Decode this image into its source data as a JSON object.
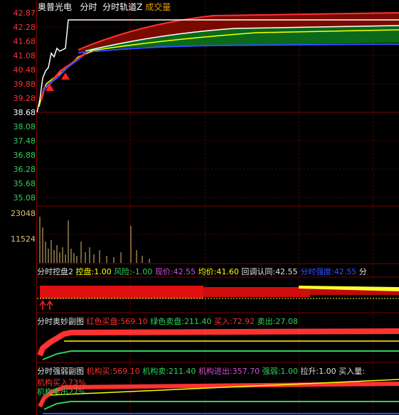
{
  "header": {
    "stock_name": "奥普光电",
    "tab_timeshare": "分时",
    "indicator_channel": "分时轨道Z",
    "indicator_volume": "成交量"
  },
  "price_axis": [
    "42.87",
    "42.28",
    "41.68",
    "41.08",
    "40.48",
    "39.88",
    "39.28",
    "38.68",
    "38.08",
    "37.48",
    "36.88",
    "36.28",
    "35.68",
    "35.08"
  ],
  "volume_axis": [
    "23048",
    "11524"
  ],
  "panel1": {
    "title": "分时控盘2",
    "items": [
      {
        "label": "控盘:",
        "value": "1.00",
        "color": "#ffff00"
      },
      {
        "label": "风险:",
        "value": "-1.00",
        "color": "#2fd15a"
      },
      {
        "label": "现价:",
        "value": "42.55",
        "color": "#d050d0"
      },
      {
        "label": "均价:",
        "value": "41.60",
        "color": "#ffff00"
      },
      {
        "label": "回调认同:",
        "value": "42.55",
        "color": "#e0e0e0"
      },
      {
        "label": "分时强度:",
        "value": "42.55",
        "color": "#3050ff"
      },
      {
        "label": "分",
        "value": "",
        "color": "#e0e0e0"
      }
    ]
  },
  "panel2": {
    "title": "分时奥妙副图",
    "items": [
      {
        "label": "红色买盘:",
        "value": "569.10",
        "color": "#ff3232"
      },
      {
        "label": "绿色卖盘:",
        "value": "211.40",
        "color": "#2fd15a"
      },
      {
        "label": "买入:",
        "value": "72.92",
        "color": "#ff3232"
      },
      {
        "label": "卖出:",
        "value": "27.08",
        "color": "#2fd15a"
      }
    ]
  },
  "panel3": {
    "title": "分时强弱副图",
    "items": [
      {
        "label": "机构买:",
        "value": "569.10",
        "color": "#ff3232"
      },
      {
        "label": "机构卖:",
        "value": "211.40",
        "color": "#2fd15a"
      },
      {
        "label": "机构进出:",
        "value": "357.70",
        "color": "#d050d0"
      },
      {
        "label": "强弱:",
        "value": "1.00",
        "color": "#2fd15a"
      },
      {
        "label": "拉升:",
        "value": "1.00",
        "color": "#e0e0e0"
      },
      {
        "label": "买入量:",
        "value": "",
        "color": "#e0e0e0"
      }
    ],
    "annotation_buy": "机构买入73%",
    "annotation_sell": "机构卖出27%"
  },
  "colors": {
    "up": "#ff3232",
    "down": "#2fd15a",
    "grid": "#7a0000",
    "price_line": "#ffffff",
    "avg_line": "#ffff00"
  }
}
